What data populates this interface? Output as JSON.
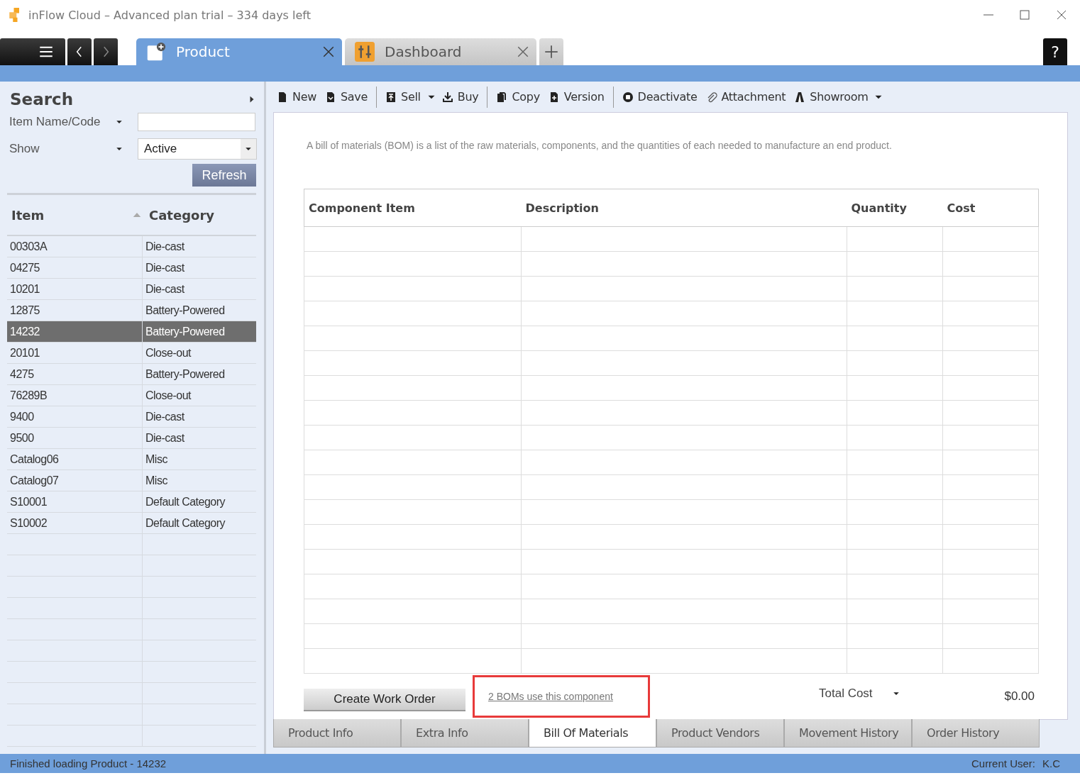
{
  "window": {
    "title": "inFlow Cloud – Advanced plan trial – 334 days left"
  },
  "doc_tabs": [
    {
      "label": "Product",
      "selected": true,
      "kind": "product"
    },
    {
      "label": "Dashboard",
      "selected": false,
      "kind": "dashboard"
    }
  ],
  "help": "?",
  "search": {
    "title": "Search",
    "fields": [
      {
        "label": "Item Name/Code",
        "kind": "text"
      },
      {
        "label": "Show",
        "kind": "select",
        "value": "Active"
      }
    ],
    "refresh": "Refresh"
  },
  "item_list": {
    "columns": [
      "Item",
      "Category"
    ],
    "rows": [
      {
        "item": "00303A",
        "category": "Die-cast",
        "selected": false
      },
      {
        "item": "04275",
        "category": "Die-cast",
        "selected": false
      },
      {
        "item": "10201",
        "category": "Die-cast",
        "selected": false
      },
      {
        "item": "12875",
        "category": "Battery-Powered",
        "selected": false
      },
      {
        "item": "14232",
        "category": "Battery-Powered",
        "selected": true
      },
      {
        "item": "20101",
        "category": "Close-out",
        "selected": false
      },
      {
        "item": "4275",
        "category": "Battery-Powered",
        "selected": false
      },
      {
        "item": "76289B",
        "category": "Close-out",
        "selected": false
      },
      {
        "item": "9400",
        "category": "Die-cast",
        "selected": false
      },
      {
        "item": "9500",
        "category": "Die-cast",
        "selected": false
      },
      {
        "item": "Catalog06",
        "category": "Misc",
        "selected": false
      },
      {
        "item": "Catalog07",
        "category": "Misc",
        "selected": false
      },
      {
        "item": "S10001",
        "category": "Default Category",
        "selected": false
      },
      {
        "item": "S10002",
        "category": "Default Category",
        "selected": false
      }
    ]
  },
  "toolbar": [
    {
      "label": "New",
      "kind": "new"
    },
    {
      "label": "Save",
      "kind": "save"
    },
    {
      "kind": "sep"
    },
    {
      "label": "Sell",
      "kind": "sell"
    },
    {
      "kind": "drop"
    },
    {
      "label": "Buy",
      "kind": "buy"
    },
    {
      "kind": "sep"
    },
    {
      "label": "Copy",
      "kind": "copy"
    },
    {
      "label": "Version",
      "kind": "version"
    },
    {
      "kind": "sep"
    },
    {
      "label": "Deactivate",
      "kind": "deactivate"
    },
    {
      "label": "Attachment",
      "kind": "attachment"
    },
    {
      "label": "Showroom",
      "kind": "showroom"
    },
    {
      "kind": "drop"
    }
  ],
  "bom": {
    "description": "A bill of materials (BOM) is a list of the raw materials, components, and the quantities of each needed to manufacture an end product.",
    "columns": [
      "Component Item",
      "Description",
      "Quantity",
      "Cost"
    ],
    "create_button": "Create Work Order",
    "link": "2 BOMs use this component",
    "total_label": "Total Cost",
    "total_value": "$0.00"
  },
  "bottom_tabs": [
    {
      "label": "Product Info",
      "selected": false
    },
    {
      "label": "Extra Info",
      "selected": false
    },
    {
      "label": "Bill Of Materials",
      "selected": true
    },
    {
      "label": "Product Vendors",
      "selected": false
    },
    {
      "label": "Movement History",
      "selected": false
    },
    {
      "label": "Order History",
      "selected": false
    }
  ],
  "status_bar": {
    "message": "Finished loading Product - 14232",
    "user_label": "Current User:",
    "user": "K.C"
  }
}
